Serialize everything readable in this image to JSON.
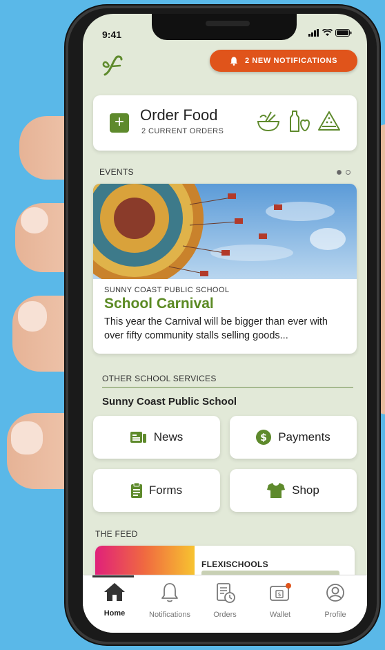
{
  "status": {
    "time": "9:41"
  },
  "header": {
    "notification_button": "2 NEW NOTIFICATIONS"
  },
  "order_food": {
    "title": "Order Food",
    "subtitle": "2 CURRENT ORDERS",
    "icons": [
      "bowl-icon",
      "bottle-apple-icon",
      "watermelon-icon"
    ]
  },
  "events": {
    "label": "EVENTS",
    "card": {
      "school": "SUNNY COAST PUBLIC SCHOOL",
      "title": "School Carnival",
      "description": "This year the Carnival will be bigger than ever with over fifty community stalls selling goods..."
    }
  },
  "services": {
    "label": "OTHER SCHOOL SERVICES",
    "school": "Sunny Coast Public School",
    "buttons": [
      {
        "label": "News",
        "icon": "news-icon"
      },
      {
        "label": "Payments",
        "icon": "dollar-icon"
      },
      {
        "label": "Forms",
        "icon": "clipboard-icon"
      },
      {
        "label": "Shop",
        "icon": "tshirt-icon"
      }
    ]
  },
  "feed": {
    "label": "THE FEED",
    "source": "FLEXISCHOOLS"
  },
  "tabs": [
    {
      "label": "Home",
      "icon": "home-icon",
      "active": true
    },
    {
      "label": "Notifications",
      "icon": "bell-icon"
    },
    {
      "label": "Orders",
      "icon": "orders-icon"
    },
    {
      "label": "Wallet",
      "icon": "wallet-icon"
    },
    {
      "label": "Profile",
      "icon": "profile-icon"
    }
  ],
  "colors": {
    "accent_green": "#5e8a2c",
    "notification_orange": "#e0541b",
    "screen_bg": "#e2e9d8",
    "background_blue": "#5ab8e8"
  }
}
